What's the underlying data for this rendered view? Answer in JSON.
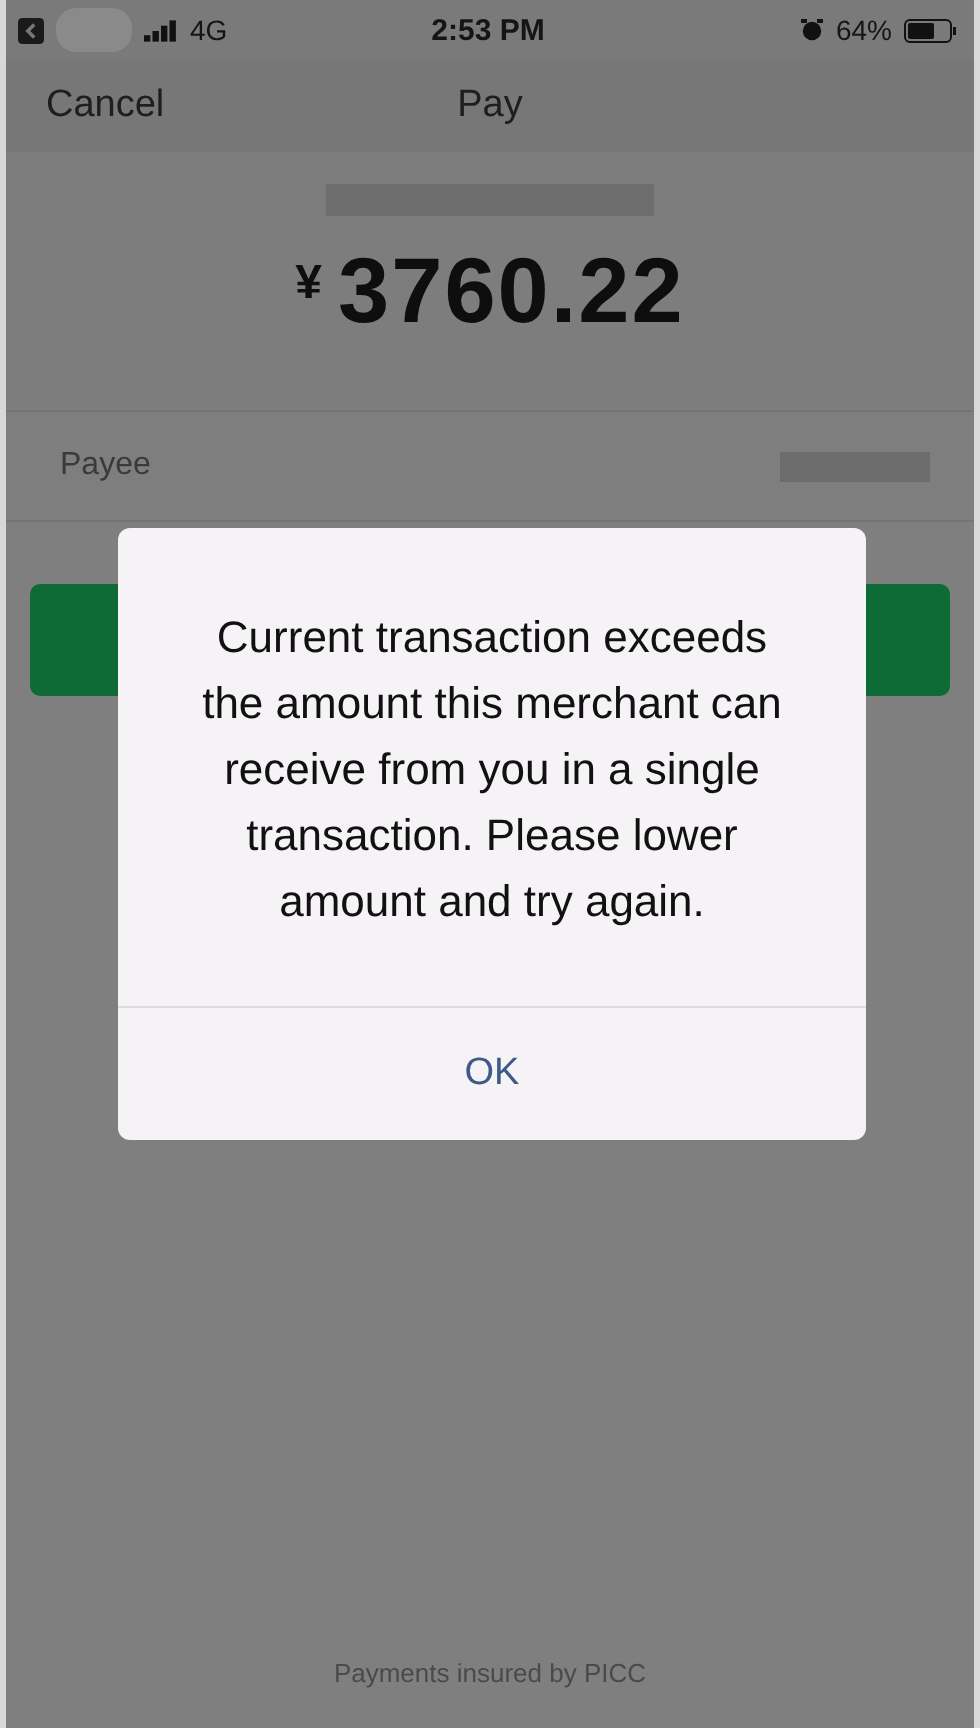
{
  "status_bar": {
    "network": "4G",
    "time": "2:53 PM",
    "battery": "64%"
  },
  "nav": {
    "cancel": "Cancel",
    "title": "Pay"
  },
  "amount": {
    "currency": "¥",
    "value": "3760.22"
  },
  "payee": {
    "label": "Payee"
  },
  "footer": "Payments insured by PICC",
  "dialog": {
    "message": "Current transaction exceeds the amount this merchant can receive from you in a single transaction. Please lower amount and try again.",
    "button": "OK"
  }
}
